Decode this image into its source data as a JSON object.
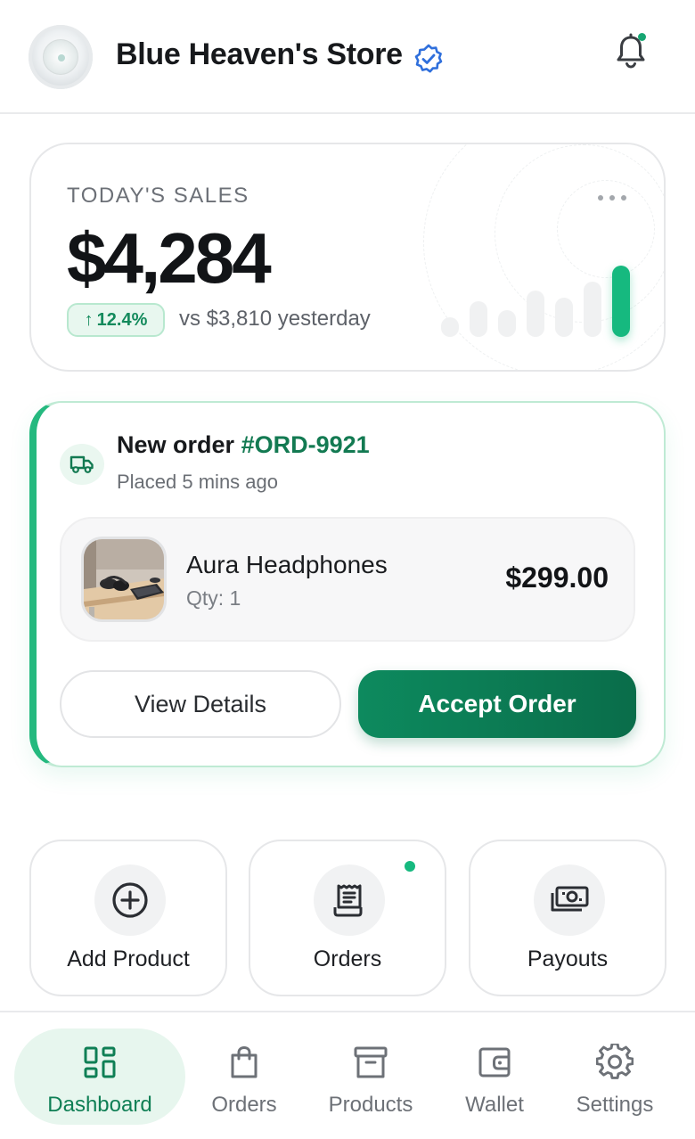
{
  "header": {
    "store_name": "Blue Heaven's Store",
    "verified_icon": "verified-badge-icon",
    "notification_icon": "bell-icon",
    "notification_dot_color": "#17a673"
  },
  "sales": {
    "label": "TODAY'S SALES",
    "value": "$4,284",
    "change": "12.4%",
    "change_direction": "up",
    "comparison": "vs $3,810 yesterday",
    "accent_color": "#16b97f"
  },
  "order": {
    "title_prefix": "New order",
    "order_id": "#ORD-9921",
    "placed": "Placed 5 mins ago",
    "product_name": "Aura Headphones",
    "product_qty": "Qty: 1",
    "product_price": "$299.00",
    "details_label": "View Details",
    "accept_label": "Accept Order",
    "accent_color": "#0d8a5e"
  },
  "quick_actions": [
    {
      "label": "Add Product",
      "icon": "add-circle-icon",
      "badge": false
    },
    {
      "label": "Orders",
      "icon": "receipt-icon",
      "badge": true
    },
    {
      "label": "Payouts",
      "icon": "cash-stack-icon",
      "badge": false
    }
  ],
  "nav": [
    {
      "label": "Dashboard",
      "icon": "dashboard-grid-icon",
      "active": true
    },
    {
      "label": "Orders",
      "icon": "shopping-bag-icon",
      "active": false
    },
    {
      "label": "Products",
      "icon": "archive-box-icon",
      "active": false
    },
    {
      "label": "Wallet",
      "icon": "wallet-icon",
      "active": false
    },
    {
      "label": "Settings",
      "icon": "gear-icon",
      "active": false
    }
  ]
}
